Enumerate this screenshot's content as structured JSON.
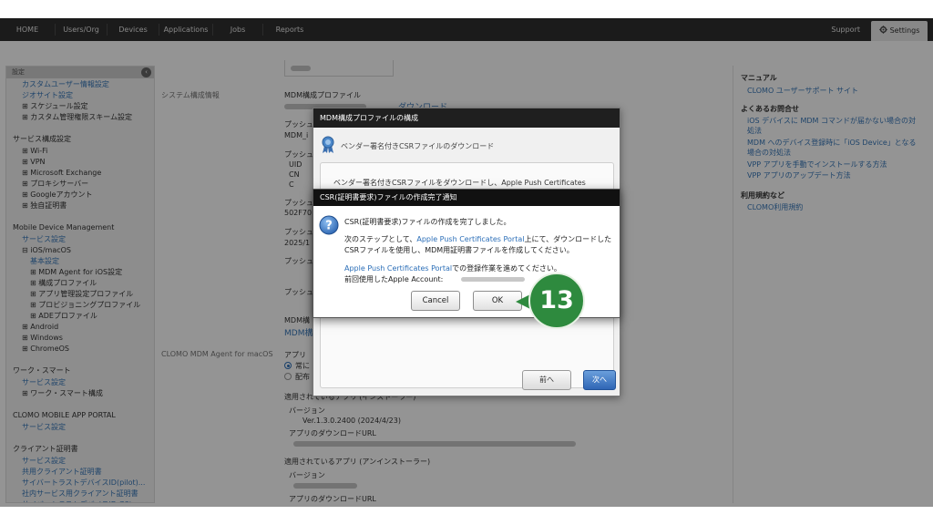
{
  "nav": {
    "items": [
      "HOME",
      "Users/Org",
      "Devices",
      "Applications",
      "Jobs",
      "Reports"
    ],
    "support": "Support",
    "settings": "Settings"
  },
  "sidebar": {
    "header": "設定",
    "collapse_icon": "chevron-left-icon",
    "lines": [
      {
        "text": "カスタムユーザー情報設定",
        "kind": "link",
        "indent": 17
      },
      {
        "text": "ジオサイト設定",
        "kind": "link",
        "indent": 17
      },
      {
        "text": "⊞ スケジュール設定",
        "kind": "item",
        "indent": 17
      },
      {
        "text": "⊞ カスタム管理権限スキーム設定",
        "kind": "item",
        "indent": 17
      },
      {
        "text": "",
        "kind": "gap",
        "indent": 0
      },
      {
        "text": "サービス構成設定",
        "kind": "section",
        "indent": 0
      },
      {
        "text": "⊞ Wi-Fi",
        "kind": "item",
        "indent": 17
      },
      {
        "text": "⊞ VPN",
        "kind": "item",
        "indent": 17
      },
      {
        "text": "⊞ Microsoft Exchange",
        "kind": "item",
        "indent": 17
      },
      {
        "text": "⊞ プロキシサーバー",
        "kind": "item",
        "indent": 17
      },
      {
        "text": "⊞ Googleアカウント",
        "kind": "item",
        "indent": 17
      },
      {
        "text": "⊞ 独自証明書",
        "kind": "item",
        "indent": 17
      },
      {
        "text": "",
        "kind": "gap",
        "indent": 0
      },
      {
        "text": "Mobile Device Management",
        "kind": "section",
        "indent": 0
      },
      {
        "text": "サービス設定",
        "kind": "link",
        "indent": 17
      },
      {
        "text": "⊟ iOS/macOS",
        "kind": "item",
        "indent": 17
      },
      {
        "text": "基本設定",
        "kind": "link",
        "indent": 26
      },
      {
        "text": "⊞ MDM Agent for iOS設定",
        "kind": "item",
        "indent": 26
      },
      {
        "text": "⊞ 構成プロファイル",
        "kind": "item",
        "indent": 26
      },
      {
        "text": "⊞ アプリ管理設定プロファイル",
        "kind": "item",
        "indent": 26
      },
      {
        "text": "⊞ プロビジョニングプロファイル",
        "kind": "item",
        "indent": 26
      },
      {
        "text": "⊞ ADEプロファイル",
        "kind": "item",
        "indent": 26
      },
      {
        "text": "⊞ Android",
        "kind": "item",
        "indent": 17
      },
      {
        "text": "⊞ Windows",
        "kind": "item",
        "indent": 17
      },
      {
        "text": "⊞ ChromeOS",
        "kind": "item",
        "indent": 17
      },
      {
        "text": "",
        "kind": "gap",
        "indent": 0
      },
      {
        "text": "ワーク・スマート",
        "kind": "section",
        "indent": 0
      },
      {
        "text": "サービス設定",
        "kind": "link",
        "indent": 17
      },
      {
        "text": "⊞ ワーク・スマート構成",
        "kind": "item",
        "indent": 17
      },
      {
        "text": "",
        "kind": "gap",
        "indent": 0
      },
      {
        "text": "CLOMO MOBILE APP PORTAL",
        "kind": "section",
        "indent": 0
      },
      {
        "text": "サービス設定",
        "kind": "link",
        "indent": 17
      },
      {
        "text": "",
        "kind": "gap",
        "indent": 0
      },
      {
        "text": "クライアント証明書",
        "kind": "section",
        "indent": 0
      },
      {
        "text": "サービス設定",
        "kind": "link",
        "indent": 17
      },
      {
        "text": "共用クライアント証明書",
        "kind": "link",
        "indent": 17
      },
      {
        "text": "サイバートラストデバイスID(pilot)...",
        "kind": "link",
        "indent": 17
      },
      {
        "text": "社内サービス用クライアント証明書",
        "kind": "link",
        "indent": 17
      },
      {
        "text": "サイバートラストデバイスID G3is...",
        "kind": "link",
        "indent": 17
      }
    ]
  },
  "main": {
    "section_system": "システム構成情報",
    "mdm_profile": "MDM構成プロファイル",
    "download": "ダウンロード",
    "push1": "プッシュ",
    "push1_val": "MDM_i",
    "push2": "プッシュ",
    "uid": "UID",
    "cn": "CN",
    "c": "C",
    "push3": "プッシュ",
    "push3_val": "502F70",
    "push4": "プッシュ",
    "push4_val": "2025/1",
    "push5": "プッシュ",
    "push6": "プッシュ",
    "mdm_profile2": "MDM構",
    "mdm_profile2_link": "MDM構",
    "section_agent": "CLOMO MDM Agent for macOS",
    "app_label": "アプリ",
    "radio_always": "常に",
    "radio_deliver": "配布",
    "applied_installer": "適用されているアプリ (インストーラー)",
    "version_label": "バージョン",
    "version_value": "Ver.1.3.0.2400 (2024/4/23)",
    "download_url": "アプリのダウンロードURL",
    "applied_uninstaller": "適用されているアプリ (アンインストーラー)",
    "version_label2": "バージョン",
    "download_url2": "アプリのダウンロードURL"
  },
  "right_panel": {
    "manual": "マニュアル",
    "support_site": "CLOMO ユーザーサポート サイト",
    "faq": "よくあるお問合せ",
    "faq_items": [
      "iOS デバイスに MDM コマンドが届かない場合の対",
      "処法",
      "MDM へのデバイス登録時に「iOS Device」となる",
      "場合の対処法",
      "VPP アプリを手動でインストールする方法",
      "VPP アプリのアップデート方法"
    ],
    "terms": "利用規約など",
    "terms_link": "CLOMO利用規約"
  },
  "wizard_dialog": {
    "title": "MDM構成プロファイルの構成",
    "step_icon": "ribbon-badge-icon",
    "step_title": "ベンダー署名付きCSRファイルのダウンロード",
    "body": "ベンダー署名付きCSRファイルをダウンロードし、Apple Push Certificates",
    "prev": "前へ",
    "next": "次へ"
  },
  "notice_dialog": {
    "title": "CSR(証明書要求)ファイルの作成完了通知",
    "icon": "question-icon",
    "line1": "CSR(証明書要求)ファイルの作成を完了しました。",
    "line2_pre": "次のステップとして、",
    "line2_link": "Apple Push Certificates Portal",
    "line2_post": "上にて、ダウンロードした",
    "line3": "CSRファイルを使用し、MDM用証明書ファイルを作成してください。",
    "line4_link": "Apple Push Certificates Portal",
    "line4_post": "での登録作業を進めてください。",
    "line5": "前回使用したApple Account:",
    "cancel": "Cancel",
    "ok": "OK"
  },
  "step_badge": "13",
  "colors": {
    "link": "#3877b8",
    "nav_bg": "#2f2f2f",
    "badge_green": "#2e8a3e",
    "next_button": "#2f66b5"
  }
}
